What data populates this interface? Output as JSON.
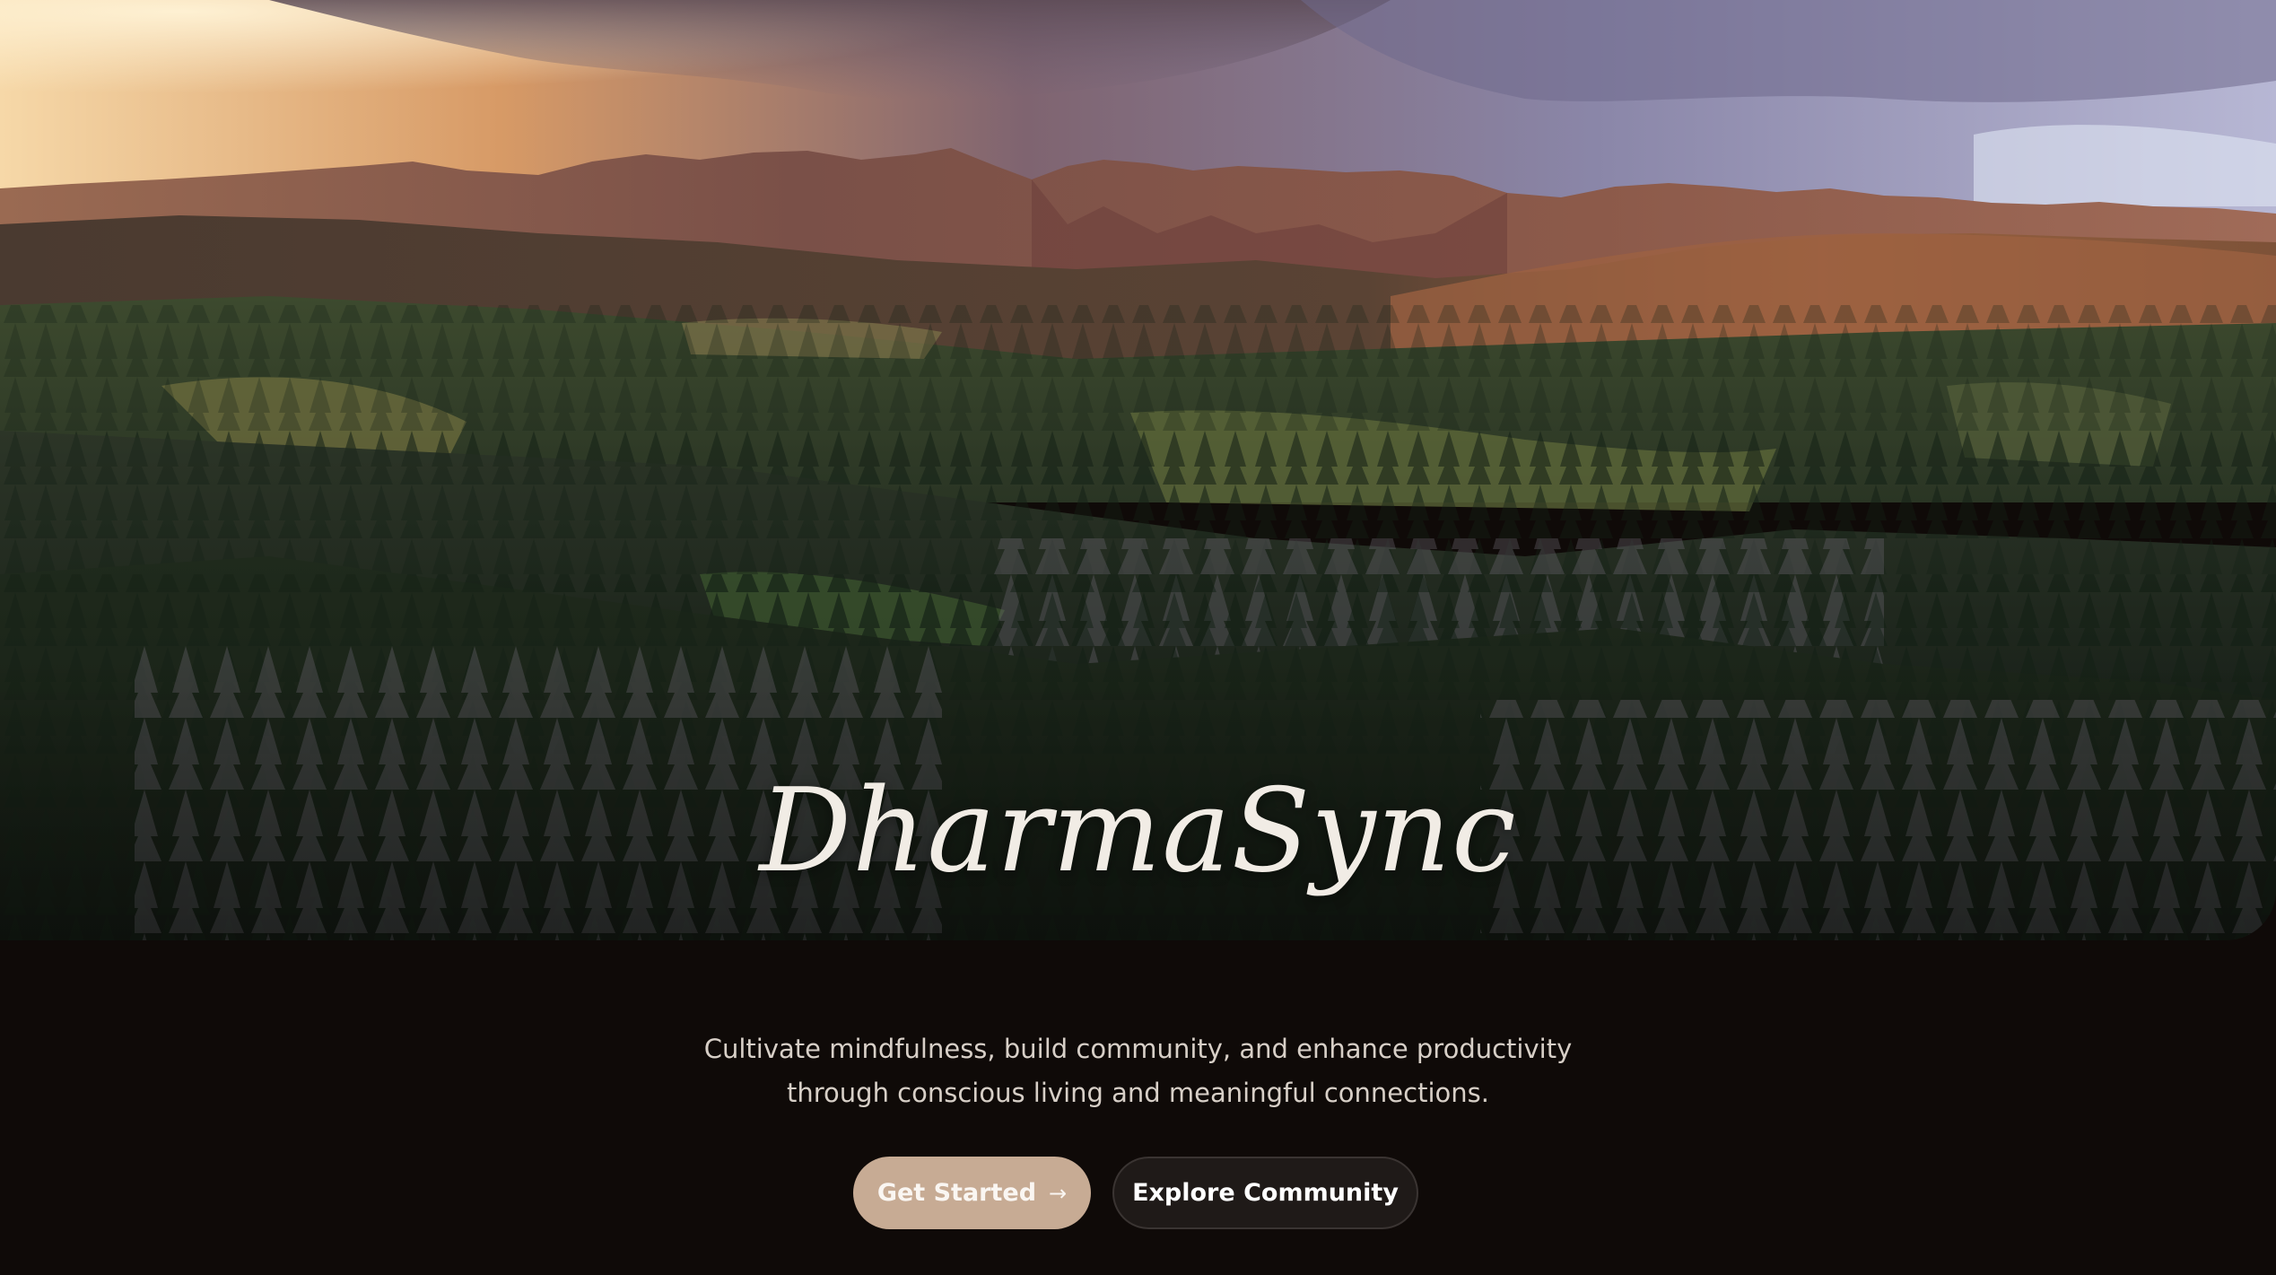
{
  "hero": {
    "title": "DharmaSync",
    "background": "mountain-forest-landscape"
  },
  "tagline": {
    "line1": "Cultivate mindfulness, build community, and enhance productivity",
    "line2": "through conscious living and meaningful connections."
  },
  "cta": {
    "primary_label": "Get Started",
    "primary_icon": "arrow-right-icon",
    "secondary_label": "Explore Community"
  },
  "colors": {
    "page_background": "#0f0a08",
    "primary_button": "#c7ab94",
    "secondary_button": "#1f1a18",
    "title_text": "#f1ece5",
    "tagline_text": "#d7cfc7"
  }
}
